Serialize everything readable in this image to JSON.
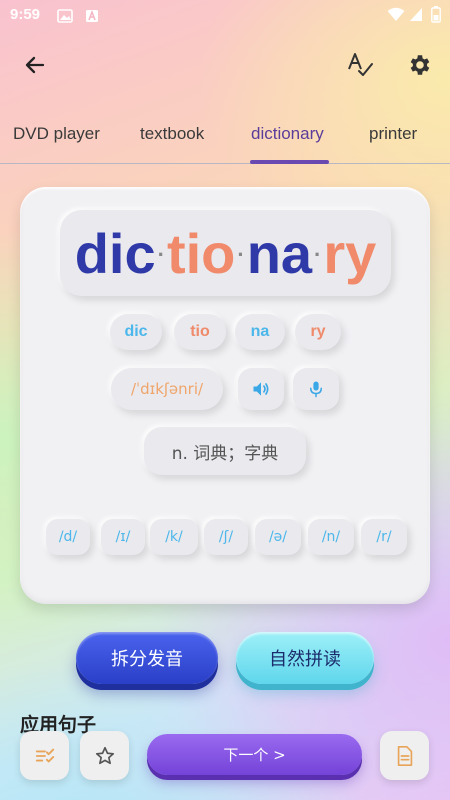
{
  "status_bar": {
    "time": "9:59"
  },
  "toolbar": {
    "back_icon": "arrow-back-icon",
    "spellcheck_icon": "spellcheck-icon",
    "settings_icon": "gear-icon"
  },
  "tabs": [
    {
      "label": "DVD player"
    },
    {
      "label": "textbook"
    },
    {
      "label": "dictionary",
      "active": true
    },
    {
      "label": "printer"
    }
  ],
  "word": {
    "syllables": [
      "dic",
      "tio",
      "na",
      "ry"
    ],
    "syllable_colors": [
      "#2f3aa8",
      "#f08a6a",
      "#2f3aa8",
      "#f08a6a"
    ],
    "phonetic": "/ˈdɪkʃənri/",
    "meaning": "n. 词典；字典"
  },
  "syllable_chips": [
    "dic",
    "tio",
    "na",
    "ry"
  ],
  "phoneme_chips": [
    "/d/",
    "/ɪ/",
    "/k/",
    "/ʃ/",
    "/ə/",
    "/n/",
    "/r/"
  ],
  "actions": {
    "split_label": "拆分发音",
    "natural_label": "自然拼读"
  },
  "example_section_title": "应用句子",
  "bottom_bar": {
    "next_label": "下一个 >"
  },
  "colors": {
    "accent_purple": "#7443d8",
    "blue": "#2f3aa8",
    "orange": "#f08a6a",
    "cyan": "#4cb7ea"
  }
}
